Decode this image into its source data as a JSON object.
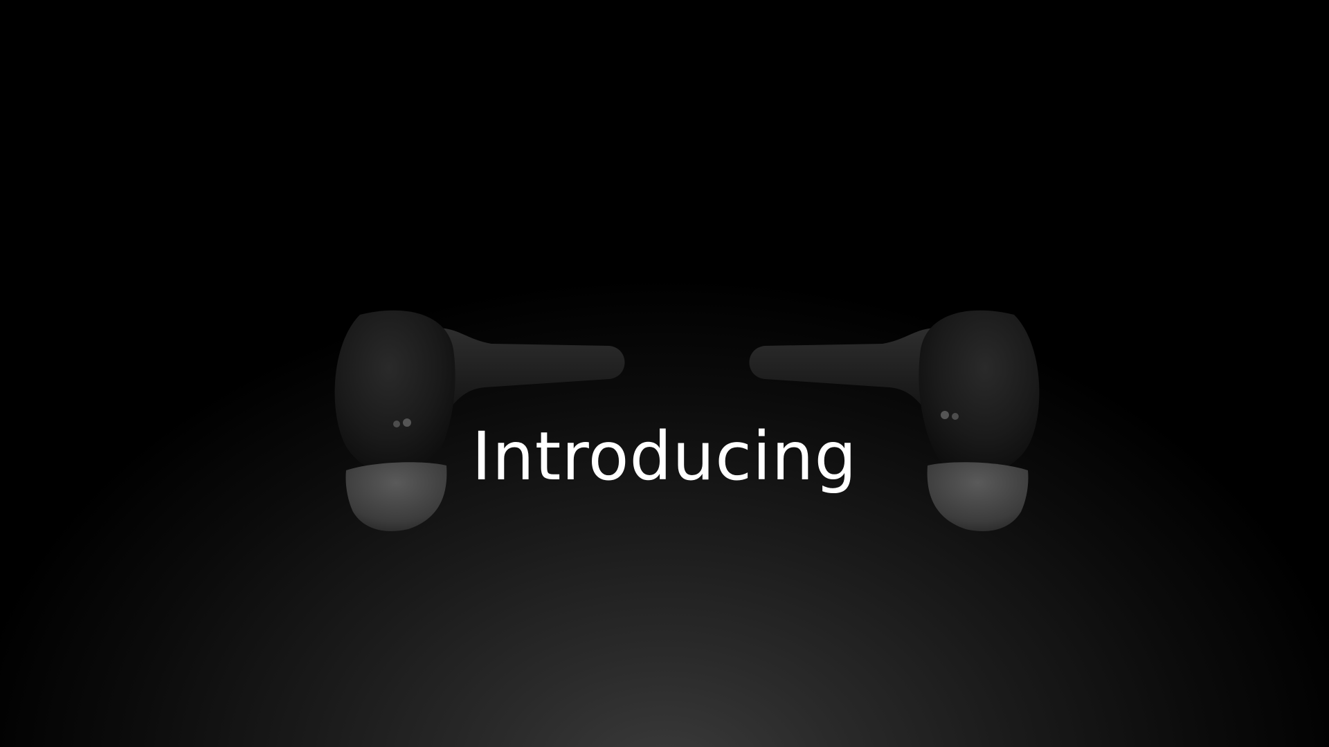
{
  "headline": {
    "text": "Introducing"
  },
  "scene": {
    "background_center_color": "#3b3b3b",
    "background_edge_color": "#000000",
    "text_color": "#ffffff",
    "earbud_body_color": "#1c1c1c",
    "earbud_tip_color": "#4a4a4a"
  },
  "icons": {
    "left_product": "earbud-left-icon",
    "right_product": "earbud-right-icon"
  }
}
